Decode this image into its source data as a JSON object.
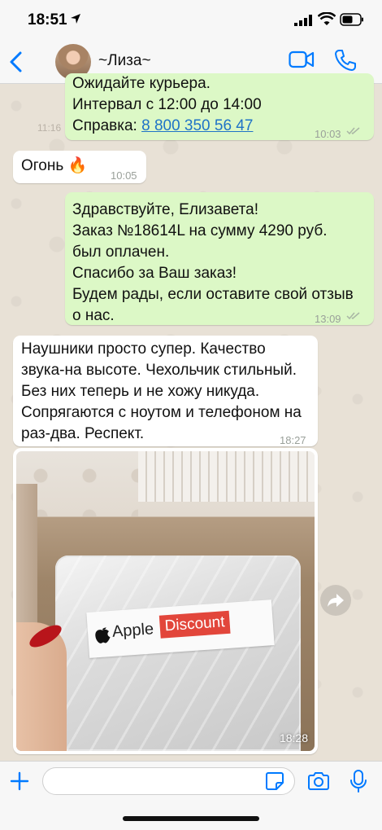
{
  "status_bar": {
    "time": "18:51"
  },
  "header": {
    "contact_name": "~Лиза~"
  },
  "messages": [
    {
      "direction": "out",
      "lines": [
        "Ожидайте курьера.",
        "Интервал с 12:00 до 14:00",
        "Справка: "
      ],
      "link": "8 800 350 56 47",
      "time": "10:03"
    },
    {
      "direction": "in",
      "text": "Огонь 🔥",
      "time": "10:05"
    },
    {
      "direction": "out",
      "lines": [
        "Здравствуйте, Елизавета!",
        "Заказ №18614L на сумму 4290 руб.",
        "был оплачен.",
        "Спасибо за Ваш заказ!",
        "Будем рады, если оставите свой отзыв",
        "о нас."
      ],
      "time": "13:09"
    },
    {
      "direction": "in",
      "lines": [
        "Наушники просто супер. Качество",
        "звука-на высоте. Чехольчик стильный.",
        "Без них теперь и не хожу никуда.",
        "Сопрягаются с ноутом и телефоном на",
        "раз-два. Респект."
      ],
      "time": "18:27"
    },
    {
      "direction": "in",
      "type": "photo",
      "time": "18:28",
      "label": {
        "brand": "Apple",
        "brand_accent": "Discount"
      }
    }
  ],
  "ghost_timestamp": "11:16",
  "colors": {
    "accent": "#007aff",
    "outgoing": "#dcf8c6",
    "incoming": "#ffffff",
    "label_red": "#e2463b"
  }
}
